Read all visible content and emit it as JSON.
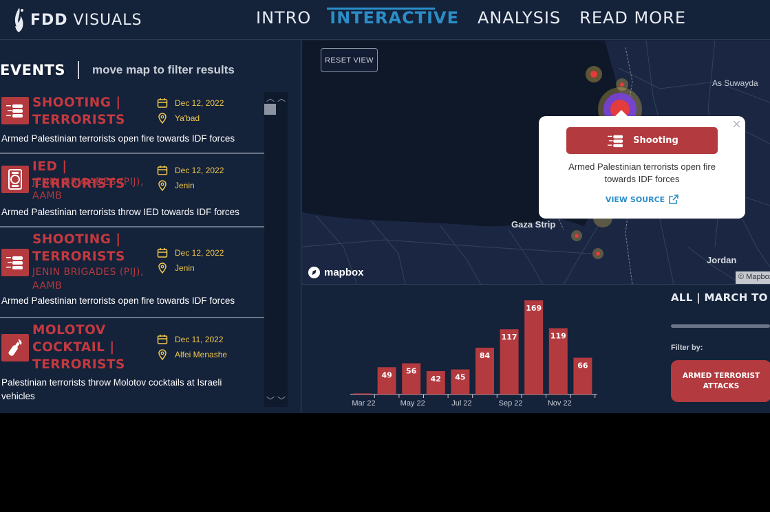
{
  "brand": {
    "name_bold": "FDD",
    "name_rest": " VISUALS"
  },
  "nav": [
    {
      "label": "INTRO"
    },
    {
      "label": "INTERACTIVE",
      "active": true
    },
    {
      "label": "ANALYSIS"
    },
    {
      "label": "READ MORE"
    }
  ],
  "events": {
    "title": "EVENTS",
    "subtitle": "move map to filter results",
    "items": [
      {
        "icon": "shooting-icon",
        "title": "SHOOTING | TERRORISTS",
        "actor": "",
        "date": "Dec 12, 2022",
        "location": "Ya'bad",
        "description": "Armed Palestinian terrorists open fire towards IDF forces"
      },
      {
        "icon": "ied-icon",
        "title": "IED | TERRORISTS",
        "actor": "JENIN BRIGADES (PIJ), AAMB",
        "date": "Dec 12, 2022",
        "location": "Jenin",
        "description": "Armed Palestinian terrorists throw IED towards IDF forces"
      },
      {
        "icon": "shooting-icon",
        "title": "SHOOTING | TERRORISTS",
        "actor": "JENIN BRIGADES (PIJ), AAMB",
        "date": "Dec 12, 2022",
        "location": "Jenin",
        "description": "Armed Palestinian terrorists open fire towards IDF forces"
      },
      {
        "icon": "molotov-icon",
        "title": "MOLOTOV COCKTAIL | TERRORISTS",
        "actor": "",
        "date": "Dec 11, 2022",
        "location": "Alfei Menashe",
        "description": "Palestinian terrorists throw Molotov cocktails at Israeli vehicles"
      }
    ]
  },
  "map": {
    "reset_label": "RESET VIEW",
    "labels": {
      "as_suwayda": "As Suwayda",
      "gaza": "Gaza Strip",
      "jordan": "Jordan"
    },
    "mapbox": "mapbox",
    "attribution": "© Mapbox",
    "popup": {
      "type": "Shooting",
      "text": "Armed Palestinian terrorists open fire towards IDF forces",
      "source_label": "VIEW SOURCE",
      "close": "×"
    }
  },
  "chart_data": {
    "type": "bar",
    "categories": [
      "Mar 22",
      "Apr 22",
      "May 22",
      "Jun 22",
      "Jul 22",
      "Aug 22",
      "Sep 22",
      "Oct 22",
      "Nov 22",
      "Dec 22"
    ],
    "values": [
      2,
      49,
      56,
      42,
      45,
      84,
      117,
      169,
      119,
      66
    ],
    "labels": [
      "",
      "49",
      "56",
      "42",
      "45",
      "84",
      "117",
      "169",
      "119",
      "66"
    ],
    "tick_labels": [
      "Mar 22",
      "",
      "May 22",
      "",
      "Jul 22",
      "",
      "Sep 22",
      "",
      "Nov 22",
      ""
    ],
    "ylim": [
      0,
      169
    ],
    "color": "#b33a3e"
  },
  "sidebar": {
    "range_title": "ALL | MARCH TO D",
    "filter_label": "Filter by:",
    "filter_button": "ARMED TERRORIST ATTACKS"
  },
  "colors": {
    "bg": "#14223a",
    "accent": "#2b8ec8",
    "red": "#b33a3e",
    "yellow": "#f2c94c"
  }
}
